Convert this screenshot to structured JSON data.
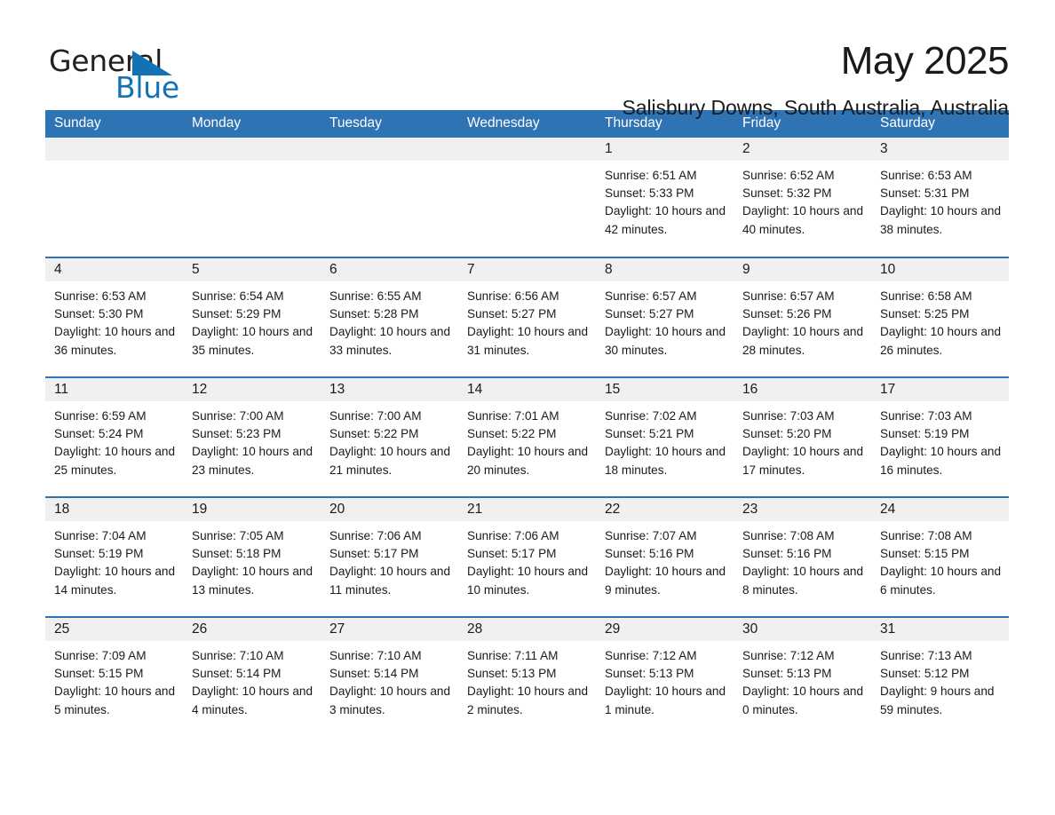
{
  "brand": {
    "name_part1": "General",
    "name_part2": "Blue",
    "accent_color": "#1272b6"
  },
  "header": {
    "month_title": "May 2025",
    "location": "Salisbury Downs, South Australia, Australia"
  },
  "theme": {
    "header_blue": "#2e74b5",
    "daynum_gray": "#f0f0f0"
  },
  "calendar": {
    "weekday_headers": [
      "Sunday",
      "Monday",
      "Tuesday",
      "Wednesday",
      "Thursday",
      "Friday",
      "Saturday"
    ],
    "weeks": [
      [
        {
          "day": "",
          "empty": true
        },
        {
          "day": "",
          "empty": true
        },
        {
          "day": "",
          "empty": true
        },
        {
          "day": "",
          "empty": true
        },
        {
          "day": "1",
          "sunrise": "Sunrise: 6:51 AM",
          "sunset": "Sunset: 5:33 PM",
          "daylight": "Daylight: 10 hours and 42 minutes."
        },
        {
          "day": "2",
          "sunrise": "Sunrise: 6:52 AM",
          "sunset": "Sunset: 5:32 PM",
          "daylight": "Daylight: 10 hours and 40 minutes."
        },
        {
          "day": "3",
          "sunrise": "Sunrise: 6:53 AM",
          "sunset": "Sunset: 5:31 PM",
          "daylight": "Daylight: 10 hours and 38 minutes."
        }
      ],
      [
        {
          "day": "4",
          "sunrise": "Sunrise: 6:53 AM",
          "sunset": "Sunset: 5:30 PM",
          "daylight": "Daylight: 10 hours and 36 minutes."
        },
        {
          "day": "5",
          "sunrise": "Sunrise: 6:54 AM",
          "sunset": "Sunset: 5:29 PM",
          "daylight": "Daylight: 10 hours and 35 minutes."
        },
        {
          "day": "6",
          "sunrise": "Sunrise: 6:55 AM",
          "sunset": "Sunset: 5:28 PM",
          "daylight": "Daylight: 10 hours and 33 minutes."
        },
        {
          "day": "7",
          "sunrise": "Sunrise: 6:56 AM",
          "sunset": "Sunset: 5:27 PM",
          "daylight": "Daylight: 10 hours and 31 minutes."
        },
        {
          "day": "8",
          "sunrise": "Sunrise: 6:57 AM",
          "sunset": "Sunset: 5:27 PM",
          "daylight": "Daylight: 10 hours and 30 minutes."
        },
        {
          "day": "9",
          "sunrise": "Sunrise: 6:57 AM",
          "sunset": "Sunset: 5:26 PM",
          "daylight": "Daylight: 10 hours and 28 minutes."
        },
        {
          "day": "10",
          "sunrise": "Sunrise: 6:58 AM",
          "sunset": "Sunset: 5:25 PM",
          "daylight": "Daylight: 10 hours and 26 minutes."
        }
      ],
      [
        {
          "day": "11",
          "sunrise": "Sunrise: 6:59 AM",
          "sunset": "Sunset: 5:24 PM",
          "daylight": "Daylight: 10 hours and 25 minutes."
        },
        {
          "day": "12",
          "sunrise": "Sunrise: 7:00 AM",
          "sunset": "Sunset: 5:23 PM",
          "daylight": "Daylight: 10 hours and 23 minutes."
        },
        {
          "day": "13",
          "sunrise": "Sunrise: 7:00 AM",
          "sunset": "Sunset: 5:22 PM",
          "daylight": "Daylight: 10 hours and 21 minutes."
        },
        {
          "day": "14",
          "sunrise": "Sunrise: 7:01 AM",
          "sunset": "Sunset: 5:22 PM",
          "daylight": "Daylight: 10 hours and 20 minutes."
        },
        {
          "day": "15",
          "sunrise": "Sunrise: 7:02 AM",
          "sunset": "Sunset: 5:21 PM",
          "daylight": "Daylight: 10 hours and 18 minutes."
        },
        {
          "day": "16",
          "sunrise": "Sunrise: 7:03 AM",
          "sunset": "Sunset: 5:20 PM",
          "daylight": "Daylight: 10 hours and 17 minutes."
        },
        {
          "day": "17",
          "sunrise": "Sunrise: 7:03 AM",
          "sunset": "Sunset: 5:19 PM",
          "daylight": "Daylight: 10 hours and 16 minutes."
        }
      ],
      [
        {
          "day": "18",
          "sunrise": "Sunrise: 7:04 AM",
          "sunset": "Sunset: 5:19 PM",
          "daylight": "Daylight: 10 hours and 14 minutes."
        },
        {
          "day": "19",
          "sunrise": "Sunrise: 7:05 AM",
          "sunset": "Sunset: 5:18 PM",
          "daylight": "Daylight: 10 hours and 13 minutes."
        },
        {
          "day": "20",
          "sunrise": "Sunrise: 7:06 AM",
          "sunset": "Sunset: 5:17 PM",
          "daylight": "Daylight: 10 hours and 11 minutes."
        },
        {
          "day": "21",
          "sunrise": "Sunrise: 7:06 AM",
          "sunset": "Sunset: 5:17 PM",
          "daylight": "Daylight: 10 hours and 10 minutes."
        },
        {
          "day": "22",
          "sunrise": "Sunrise: 7:07 AM",
          "sunset": "Sunset: 5:16 PM",
          "daylight": "Daylight: 10 hours and 9 minutes."
        },
        {
          "day": "23",
          "sunrise": "Sunrise: 7:08 AM",
          "sunset": "Sunset: 5:16 PM",
          "daylight": "Daylight: 10 hours and 8 minutes."
        },
        {
          "day": "24",
          "sunrise": "Sunrise: 7:08 AM",
          "sunset": "Sunset: 5:15 PM",
          "daylight": "Daylight: 10 hours and 6 minutes."
        }
      ],
      [
        {
          "day": "25",
          "sunrise": "Sunrise: 7:09 AM",
          "sunset": "Sunset: 5:15 PM",
          "daylight": "Daylight: 10 hours and 5 minutes."
        },
        {
          "day": "26",
          "sunrise": "Sunrise: 7:10 AM",
          "sunset": "Sunset: 5:14 PM",
          "daylight": "Daylight: 10 hours and 4 minutes."
        },
        {
          "day": "27",
          "sunrise": "Sunrise: 7:10 AM",
          "sunset": "Sunset: 5:14 PM",
          "daylight": "Daylight: 10 hours and 3 minutes."
        },
        {
          "day": "28",
          "sunrise": "Sunrise: 7:11 AM",
          "sunset": "Sunset: 5:13 PM",
          "daylight": "Daylight: 10 hours and 2 minutes."
        },
        {
          "day": "29",
          "sunrise": "Sunrise: 7:12 AM",
          "sunset": "Sunset: 5:13 PM",
          "daylight": "Daylight: 10 hours and 1 minute."
        },
        {
          "day": "30",
          "sunrise": "Sunrise: 7:12 AM",
          "sunset": "Sunset: 5:13 PM",
          "daylight": "Daylight: 10 hours and 0 minutes."
        },
        {
          "day": "31",
          "sunrise": "Sunrise: 7:13 AM",
          "sunset": "Sunset: 5:12 PM",
          "daylight": "Daylight: 9 hours and 59 minutes."
        }
      ]
    ]
  }
}
